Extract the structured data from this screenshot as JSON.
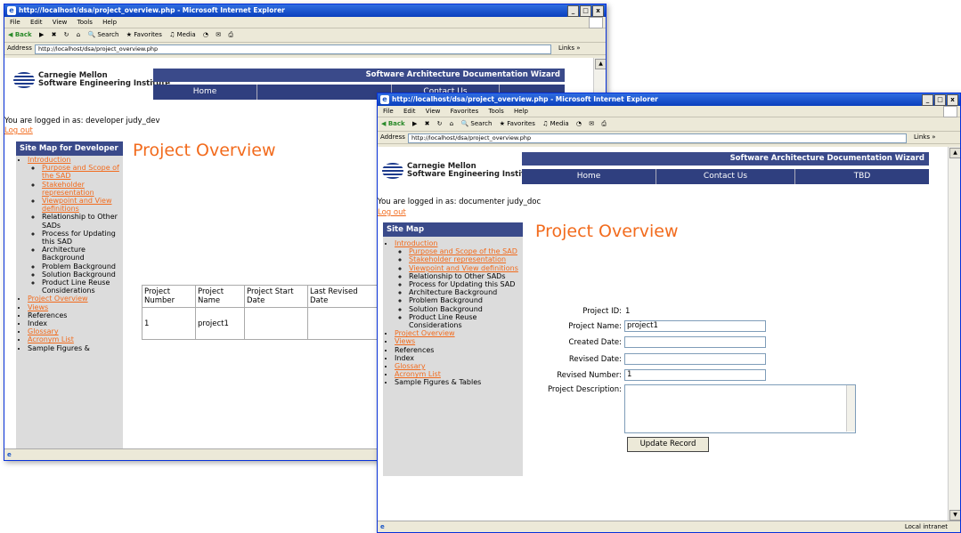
{
  "window1": {
    "title": "http://localhost/dsa/project_overview.php - Microsoft Internet Explorer",
    "menu": [
      "File",
      "Edit",
      "View",
      "Tools",
      "Help"
    ],
    "toolbar": {
      "back": "Back",
      "search": "Search",
      "favorites": "Favorites",
      "media": "Media"
    },
    "address_label": "Address",
    "address_value": "http://localhost/dsa/project_overview.php",
    "links_label": "Links »",
    "header": {
      "wizard_title": "Software Architecture Documentation Wizard",
      "org_line1": "Carnegie Mellon",
      "org_line2": "Software Engineering Institute"
    },
    "nav": [
      "Home",
      "Contact Us"
    ],
    "login_text": "You are logged in as: developer judy_dev",
    "logout_text": "Log out",
    "sitemap_title": "Site Map for Developer",
    "sitemap": {
      "introduction": "Introduction",
      "intro_sub": [
        {
          "label": "Purpose and Scope of the SAD",
          "link": true
        },
        {
          "label": "Stakeholder representation",
          "link": true
        },
        {
          "label": "Viewpoint and View definitions",
          "link": true
        },
        {
          "label": "Relationship to Other SADs",
          "link": false
        },
        {
          "label": "Process for Updating this SAD",
          "link": false
        },
        {
          "label": "Architecture Background",
          "link": false
        },
        {
          "label": "Problem Background",
          "link": false
        },
        {
          "label": "Solution Background",
          "link": false
        },
        {
          "label": "Product Line Reuse Considerations",
          "link": false
        }
      ],
      "top": [
        {
          "label": "Project Overview",
          "link": true
        },
        {
          "label": "Views",
          "link": true
        },
        {
          "label": "References",
          "link": false
        },
        {
          "label": "Index",
          "link": false
        },
        {
          "label": "Glossary",
          "link": true
        },
        {
          "label": "Acronym List",
          "link": true
        },
        {
          "label": "Sample Figures &",
          "link": false
        }
      ]
    },
    "page_title": "Project Overview",
    "table": {
      "headers": [
        "Project Number",
        "Project Name",
        "Project Start Date",
        "Last Revised Date"
      ],
      "row": [
        "1",
        "project1",
        "",
        ""
      ]
    }
  },
  "window2": {
    "title": "http://localhost/dsa/project_overview.php - Microsoft Internet Explorer",
    "menu": [
      "File",
      "Edit",
      "View",
      "Favorites",
      "Tools",
      "Help"
    ],
    "toolbar": {
      "back": "Back",
      "search": "Search",
      "favorites": "Favorites",
      "media": "Media"
    },
    "address_label": "Address",
    "address_value": "http://localhost/dsa/project_overview.php",
    "links_label": "Links »",
    "header": {
      "wizard_title": "Software Architecture Documentation Wizard",
      "org_line1": "Carnegie Mellon",
      "org_line2": "Software Engineering Institute"
    },
    "nav": [
      "Home",
      "Contact Us",
      "TBD"
    ],
    "login_text": "You are logged in as: documenter judy_doc",
    "logout_text": "Log out",
    "sitemap_title": "Site Map",
    "sitemap": {
      "introduction": "Introduction",
      "intro_sub": [
        {
          "label": "Purpose and Scope of the SAD",
          "link": true
        },
        {
          "label": "Stakeholder representation",
          "link": true
        },
        {
          "label": "Viewpoint and View definitions",
          "link": true
        },
        {
          "label": "Relationship to Other SADs",
          "link": false
        },
        {
          "label": "Process for Updating this SAD",
          "link": false
        },
        {
          "label": "Architecture Background",
          "link": false
        },
        {
          "label": "Problem Background",
          "link": false
        },
        {
          "label": "Solution Background",
          "link": false
        },
        {
          "label": "Product Line Reuse Considerations",
          "link": false
        }
      ],
      "top": [
        {
          "label": "Project Overview",
          "link": true
        },
        {
          "label": "Views",
          "link": true
        },
        {
          "label": "References",
          "link": false
        },
        {
          "label": "Index",
          "link": false
        },
        {
          "label": "Glossary",
          "link": true
        },
        {
          "label": "Acronym List",
          "link": true
        },
        {
          "label": "Sample Figures & Tables",
          "link": false
        }
      ]
    },
    "page_title": "Project Overview",
    "form": {
      "project_id_label": "Project ID:",
      "project_id_value": "1",
      "project_name_label": "Project Name:",
      "project_name_value": "project1",
      "created_date_label": "Created Date:",
      "created_date_value": "",
      "revised_date_label": "Revised Date:",
      "revised_date_value": "",
      "revised_number_label": "Revised Number:",
      "revised_number_value": "1",
      "description_label": "Project Description:",
      "description_value": "",
      "update_button": "Update Record"
    },
    "status_zone": "Local intranet"
  },
  "colors": {
    "accent_orange": "#f26b1d",
    "header_blue": "#3a4a8a",
    "titlebar_blue": "#0a3fbd"
  }
}
